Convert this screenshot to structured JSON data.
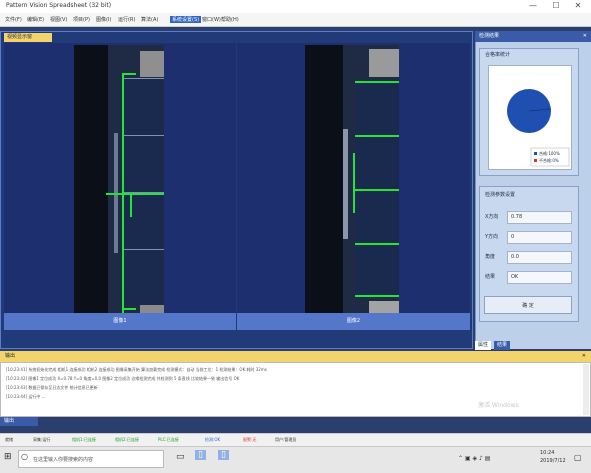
{
  "window": {
    "title": "Pattern Vision Spreadsheet (32 bit)",
    "minimize": "—",
    "maximize": "☐",
    "close": "✕"
  },
  "menu": [
    "文件(F)",
    "编辑(E)",
    "视图(V)",
    "项目(P)",
    "图像(I)",
    "运行(R)",
    "算法(A)",
    "系统设置(S)",
    "窗口(W)",
    "帮助(H)"
  ],
  "menu_active_index": 7,
  "view": {
    "tab_label": "视频显示窗",
    "panes": [
      {
        "label": "图像1"
      },
      {
        "label": "图像2"
      }
    ]
  },
  "right_panel": {
    "title": "检测结果",
    "close": "✕",
    "chart_group_label": "合格率统计",
    "pie_legend": [
      "合格:100%",
      "不合格:0%"
    ],
    "pie_pass_fraction": 1.0,
    "params_group_label": "检测参数设置",
    "fields": [
      {
        "label": "X方向",
        "value": "0.78"
      },
      {
        "label": "Y方向",
        "value": "0"
      },
      {
        "label": "角度",
        "value": "0.0"
      },
      {
        "label": "结果",
        "value": "OK"
      }
    ],
    "confirm_button": "确 定",
    "tabs": [
      "属性",
      "结果"
    ]
  },
  "output": {
    "title": "输出",
    "close": "✕",
    "lines": [
      "[10:23:41] 系统初始化完成  相机1 连接成功  相机2 连接成功  图像采集开始  算法加载完成  检测模式：自动  当前工位：1  检测结果：OK  耗时 32ms",
      "[10:23:42] 图像1 定位成功 X=0.78 Y=0 角度=0.0  图像2 定位成功  边缘检测完成  共检测到 5 条直线  比较结果一致  输出信号 OK",
      "[10:23:43] 数据已保存至日志文件  统计信息已更新",
      "[10:23:44] 运行中 ..."
    ],
    "tab_label": "输出"
  },
  "watermark": "激活 Windows",
  "status": [
    {
      "text": "就绪",
      "color": "#333333"
    },
    {
      "text": "采集:运行",
      "color": "#333333"
    },
    {
      "text": "相机1:已连接",
      "color": "#1b9a2f"
    },
    {
      "text": "相机2:已连接",
      "color": "#1b9a2f"
    },
    {
      "text": "PLC:已连接",
      "color": "#1b9a2f"
    },
    {
      "text": "检测:OK",
      "color": "#2b5fcf"
    },
    {
      "text": "报警:无",
      "color": "#d23333"
    },
    {
      "text": "用户:管理员",
      "color": "#333333"
    }
  ],
  "taskbar": {
    "search_placeholder": "在这里输入你要搜索的内容",
    "time": "10:24",
    "date": "2019/7/12"
  }
}
